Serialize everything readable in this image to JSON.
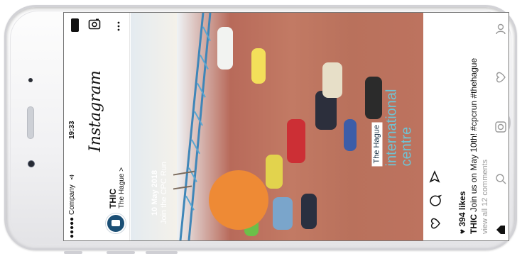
{
  "status": {
    "carrier": "●●●●● Company",
    "time": "19:33"
  },
  "app": {
    "name": "Instagram"
  },
  "post": {
    "username": "THIC",
    "location": "The Hague",
    "location_chevron": ">",
    "likes": "394 likes",
    "caption_user": "THIC",
    "caption_text": "Join us on May 10th! #cpcrun #thehague",
    "comments_link": "view all 12 comments",
    "more_icon": "more-dots-icon"
  },
  "image": {
    "badge_date": "10 May 2018",
    "badge_text": "Join the CPC Run",
    "brand_label": "The Hague",
    "brand_line1": "international",
    "brand_line2": "centre"
  },
  "colors": {
    "accent_orange": "#ee8a35",
    "brand_blue": "#2e5774",
    "brand_cyan": "#6fc3d4"
  },
  "icons": [
    "camera-icon",
    "battery-icon",
    "heart-icon",
    "comment-icon",
    "share-icon",
    "home-icon",
    "search-icon",
    "add-post-icon",
    "activity-icon",
    "profile-icon"
  ]
}
